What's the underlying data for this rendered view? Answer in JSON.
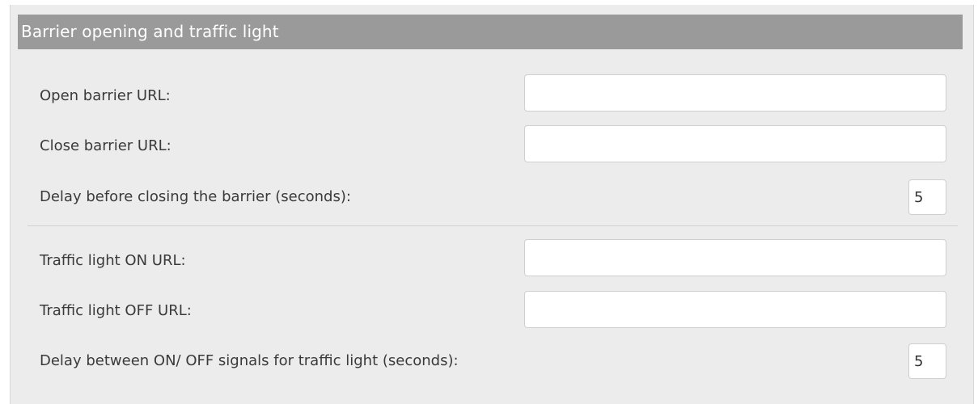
{
  "section": {
    "title": "Barrier opening and traffic light"
  },
  "fields": {
    "open_barrier_url": {
      "label": "Open barrier URL:",
      "value": ""
    },
    "close_barrier_url": {
      "label": "Close barrier URL:",
      "value": ""
    },
    "close_delay": {
      "label": "Delay before closing the barrier (seconds):",
      "value": "5"
    },
    "traffic_on_url": {
      "label": "Traffic light ON URL:",
      "value": ""
    },
    "traffic_off_url": {
      "label": "Traffic light OFF URL:",
      "value": ""
    },
    "traffic_delay": {
      "label": "Delay between ON/ OFF signals for traffic light (seconds):",
      "value": "5"
    }
  },
  "colors": {
    "header_bg": "#9a9a9a",
    "panel_bg": "#ececec"
  }
}
